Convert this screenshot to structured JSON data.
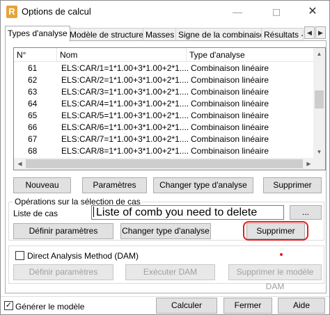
{
  "window": {
    "title": "Options de calcul",
    "app_icon_letter": "R"
  },
  "tabs": [
    {
      "label": "Types d'analyse",
      "active": true
    },
    {
      "label": "Modèle de structure",
      "active": false
    },
    {
      "label": "Masses",
      "active": false
    },
    {
      "label": "Signe de la combinaison",
      "active": false
    },
    {
      "label": "Résultats - f",
      "active": false
    }
  ],
  "list": {
    "columns": [
      "N°",
      "Nom",
      "Type d'analyse"
    ],
    "rows": [
      {
        "no": "61",
        "nom": "ELS:CAR/1=1*1.00+3*1.00+2*1....",
        "type": "Combinaison linéaire"
      },
      {
        "no": "62",
        "nom": "ELS:CAR/2=1*1.00+3*1.00+2*1....",
        "type": "Combinaison linéaire"
      },
      {
        "no": "63",
        "nom": "ELS:CAR/3=1*1.00+3*1.00+2*1....",
        "type": "Combinaison linéaire"
      },
      {
        "no": "64",
        "nom": "ELS:CAR/4=1*1.00+3*1.00+2*1....",
        "type": "Combinaison linéaire"
      },
      {
        "no": "65",
        "nom": "ELS:CAR/5=1*1.00+3*1.00+2*1....",
        "type": "Combinaison linéaire"
      },
      {
        "no": "66",
        "nom": "ELS:CAR/6=1*1.00+3*1.00+2*1....",
        "type": "Combinaison linéaire"
      },
      {
        "no": "67",
        "nom": "ELS:CAR/7=1*1.00+3*1.00+2*1....",
        "type": "Combinaison linéaire"
      },
      {
        "no": "68",
        "nom": "ELS:CAR/8=1*1.00+3*1.00+2*1....",
        "type": "Combinaison linéaire"
      }
    ]
  },
  "list_buttons": {
    "nouveau": "Nouveau",
    "parametres": "Paramètres",
    "changer_type": "Changer type d'analyse",
    "supprimer": "Supprimer"
  },
  "selection_group": {
    "title": "Opérations sur la sélection de cas",
    "liste_label": "Liste de cas",
    "liste_value": "Liste of comb you need to delete",
    "browse_label": "...",
    "definir": "Définir paramètres",
    "changer_type": "Changer type d'analyse",
    "supprimer": "Supprimer"
  },
  "dam_group": {
    "checkbox_label": "Direct Analysis Method (DAM)",
    "checked": false,
    "definir": "Définir paramètres",
    "executer": "Exécuter DAM",
    "supprimer": "Supprimer le modèle DAM"
  },
  "footer": {
    "generer_label": "Générer le modèle",
    "generer_checked": true,
    "calculer": "Calculer",
    "fermer": "Fermer",
    "aide": "Aide"
  },
  "colors": {
    "annotation": "#e02020",
    "button_face": "#e1e1e1"
  }
}
